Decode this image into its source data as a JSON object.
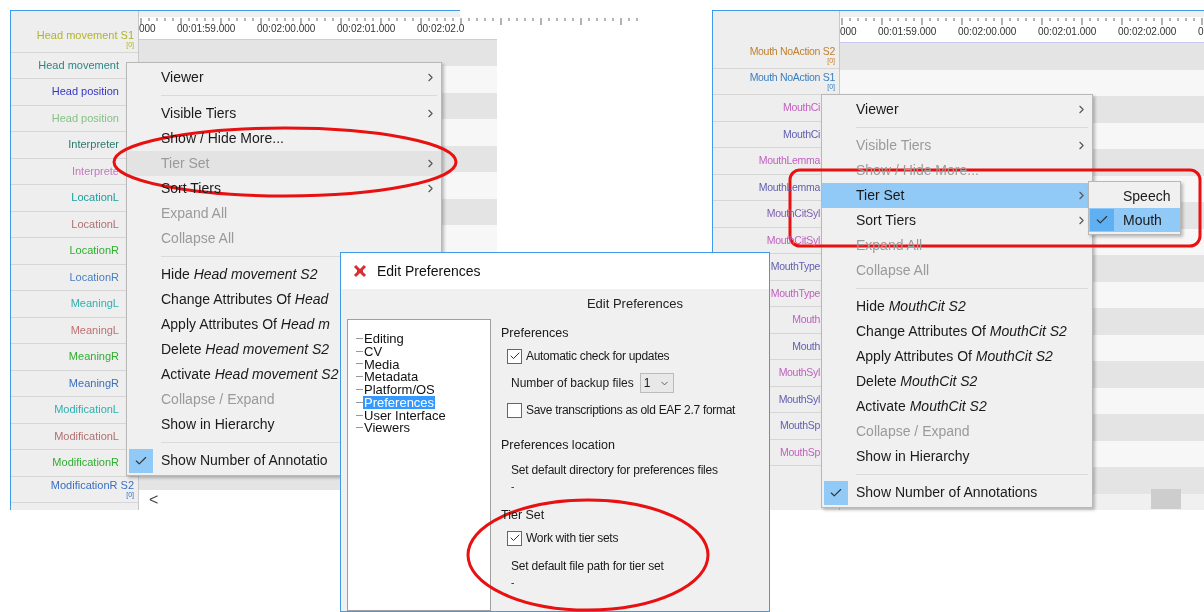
{
  "left_window": {
    "ruler": [
      "000",
      "00:01:59.000",
      "00:02:00.000",
      "00:02:01.000",
      "00:02:02.0"
    ],
    "tiers": [
      {
        "label": "Head movement S1",
        "color": "#b3b32a",
        "count": "[0]"
      },
      {
        "label": "Head movement",
        "color": "#2a8585"
      },
      {
        "label": "Head position",
        "color": "#3535c8"
      },
      {
        "label": "Head position",
        "color": "#86c286"
      },
      {
        "label": "Interpreter",
        "color": "#2a7a6e"
      },
      {
        "label": "Interprete",
        "color": "#c07ac0"
      },
      {
        "label": "LocationL",
        "color": "#1a9e9e"
      },
      {
        "label": "LocationL",
        "color": "#b07070"
      },
      {
        "label": "LocationR",
        "color": "#2fae2f"
      },
      {
        "label": "LocationR",
        "color": "#4a7fc0"
      },
      {
        "label": "MeaningL",
        "color": "#2fb0b0"
      },
      {
        "label": "MeaningL",
        "color": "#c07070"
      },
      {
        "label": "MeaningR",
        "color": "#2fae2f"
      },
      {
        "label": "MeaningR",
        "color": "#3a6fc0"
      },
      {
        "label": "ModificationL",
        "color": "#2fb0b0"
      },
      {
        "label": "ModificationL",
        "color": "#b07070"
      },
      {
        "label": "ModificationR",
        "color": "#2fae2f"
      },
      {
        "label": "ModificationR S2",
        "color": "#3a6fc0",
        "count": "[0]"
      }
    ],
    "scroll_left": "<",
    "context_menu": [
      {
        "kind": "item",
        "text": "Viewer",
        "submenu": true,
        "disabled": false,
        "selected": false,
        "checked": false
      },
      {
        "kind": "separator"
      },
      {
        "kind": "item",
        "text": "Visible Tiers",
        "submenu": true,
        "disabled": false,
        "selected": false,
        "checked": false
      },
      {
        "kind": "item",
        "text": "Show / Hide More...",
        "submenu": false,
        "disabled": false,
        "selected": false,
        "checked": false
      },
      {
        "kind": "item",
        "text": "Tier Set",
        "submenu": true,
        "disabled": true,
        "selected": true,
        "checked": false
      },
      {
        "kind": "item",
        "text": "Sort Tiers",
        "submenu": true,
        "disabled": false,
        "selected": false,
        "checked": false
      },
      {
        "kind": "item",
        "text": "Expand All",
        "submenu": false,
        "disabled": true,
        "selected": false,
        "checked": false
      },
      {
        "kind": "item",
        "text": "Collapse All",
        "submenu": false,
        "disabled": true,
        "selected": false,
        "checked": false
      },
      {
        "kind": "separator"
      },
      {
        "kind": "item",
        "text": "Hide *Head movement S2*",
        "disabled": false,
        "selected": false,
        "checked": false
      },
      {
        "kind": "item",
        "text": "Change Attributes Of *Head*",
        "disabled": false,
        "selected": false,
        "checked": false
      },
      {
        "kind": "item",
        "text": "Apply Attributes Of *Head m*",
        "disabled": false,
        "selected": false,
        "checked": false
      },
      {
        "kind": "item",
        "text": "Delete *Head movement S2*",
        "disabled": false,
        "selected": false,
        "checked": false
      },
      {
        "kind": "item",
        "text": "Activate *Head movement S2*",
        "disabled": false,
        "selected": false,
        "checked": false
      },
      {
        "kind": "item",
        "text": "Collapse / Expand",
        "disabled": true,
        "selected": false,
        "checked": false
      },
      {
        "kind": "item",
        "text": "Show in Hierarchy",
        "disabled": false,
        "selected": false,
        "checked": false
      },
      {
        "kind": "separator"
      },
      {
        "kind": "item",
        "text": "Show Number of Annotatio",
        "disabled": false,
        "selected": false,
        "checked": true
      }
    ]
  },
  "right_window": {
    "ruler": [
      "000",
      "00:01:59.000",
      "00:02:00.000",
      "00:02:01.000",
      "00:02:02.000",
      "0"
    ],
    "tiers": [
      {
        "label": "Mouth NoAction S2",
        "color": "#c0802f",
        "count": "[0]"
      },
      {
        "label": "Mouth NoAction S1",
        "color": "#3a80c0",
        "count": "[0]"
      },
      {
        "label": "MouthCi",
        "color": "#c060c0"
      },
      {
        "label": "MouthCi",
        "color": "#6060b0"
      },
      {
        "label": "MouthLemma",
        "color": "#c060c0"
      },
      {
        "label": "MouthLemma",
        "color": "#6060b0"
      },
      {
        "label": "MouthCitSyl",
        "color": "#8060b0"
      },
      {
        "label": "MouthCitSyl",
        "color": "#c060c0"
      },
      {
        "label": "MouthType",
        "color": "#6060b0"
      },
      {
        "label": "MouthType",
        "color": "#c060c0"
      },
      {
        "label": "Mouth",
        "color": "#c060c0"
      },
      {
        "label": "Mouth",
        "color": "#6060b0"
      },
      {
        "label": "MouthSyl",
        "color": "#c060c0"
      },
      {
        "label": "MouthSyl",
        "color": "#6060b0"
      },
      {
        "label": "MouthSp",
        "color": "#6060b0"
      },
      {
        "label": "MouthSp",
        "color": "#c060c0"
      }
    ],
    "context_menu": [
      {
        "kind": "item",
        "text": "Viewer",
        "submenu": true,
        "disabled": false,
        "selected": false,
        "checked": false
      },
      {
        "kind": "separator"
      },
      {
        "kind": "item",
        "text": "Visible Tiers",
        "submenu": true,
        "disabled": true,
        "selected": false,
        "checked": false
      },
      {
        "kind": "item",
        "text": "Show / Hide More...",
        "submenu": false,
        "disabled": true,
        "selected": false,
        "checked": false
      },
      {
        "kind": "item",
        "text": "Tier Set",
        "submenu": true,
        "disabled": false,
        "selected": true,
        "checked": false
      },
      {
        "kind": "item",
        "text": "Sort Tiers",
        "submenu": true,
        "disabled": false,
        "selected": false,
        "checked": false
      },
      {
        "kind": "item",
        "text": "Expand All",
        "submenu": false,
        "disabled": true,
        "selected": false,
        "checked": false
      },
      {
        "kind": "item",
        "text": "Collapse All",
        "submenu": false,
        "disabled": true,
        "selected": false,
        "checked": false
      },
      {
        "kind": "separator"
      },
      {
        "kind": "item",
        "text": "Hide *MouthCit S2*",
        "submenu": false,
        "disabled": false,
        "selected": false,
        "checked": false
      },
      {
        "kind": "item",
        "text": "Change Attributes Of *MouthCit S2*",
        "submenu": false,
        "disabled": false,
        "selected": false,
        "checked": false
      },
      {
        "kind": "item",
        "text": "Apply Attributes Of *MouthCit S2*",
        "submenu": false,
        "disabled": false,
        "selected": false,
        "checked": false
      },
      {
        "kind": "item",
        "text": "Delete *MouthCit S2*",
        "submenu": false,
        "disabled": false,
        "selected": false,
        "checked": false
      },
      {
        "kind": "item",
        "text": "Activate *MouthCit S2*",
        "submenu": false,
        "disabled": false,
        "selected": false,
        "checked": false
      },
      {
        "kind": "item",
        "text": "Collapse / Expand",
        "submenu": false,
        "disabled": true,
        "selected": false,
        "checked": false
      },
      {
        "kind": "item",
        "text": "Show in Hierarchy",
        "submenu": false,
        "disabled": false,
        "selected": false,
        "checked": false
      },
      {
        "kind": "separator"
      },
      {
        "kind": "item",
        "text": "Show Number of Annotations",
        "submenu": false,
        "disabled": false,
        "selected": false,
        "checked": true
      }
    ],
    "tier_set_submenu": [
      {
        "text": "Speech",
        "checked": false,
        "selected": false
      },
      {
        "text": "Mouth",
        "checked": true,
        "selected": true
      }
    ]
  },
  "dialog": {
    "title": "Edit Preferences",
    "heading": "Edit Preferences",
    "tree": [
      {
        "text": "Editing",
        "selected": false
      },
      {
        "text": "CV",
        "selected": false
      },
      {
        "text": "Media",
        "selected": false
      },
      {
        "text": "Metadata",
        "selected": false
      },
      {
        "text": "Platform/OS",
        "selected": false
      },
      {
        "text": "Preferences",
        "selected": true
      },
      {
        "text": "User Interface",
        "selected": false
      },
      {
        "text": "Viewers",
        "selected": false
      }
    ],
    "sections": [
      {
        "kind": "heading",
        "text": "Preferences"
      },
      {
        "kind": "checkbox",
        "text": "Automatic check for updates",
        "checked": true
      },
      {
        "kind": "select",
        "text": "Number of backup files",
        "value": "1"
      },
      {
        "kind": "checkbox",
        "text": "Save transcriptions as old EAF 2.7 format",
        "checked": false
      },
      {
        "kind": "heading",
        "text": "Preferences location"
      },
      {
        "kind": "label",
        "text": "Set default directory for preferences files"
      },
      {
        "kind": "path",
        "text": "-"
      },
      {
        "kind": "heading",
        "text": "Tier Set"
      },
      {
        "kind": "checkbox",
        "text": "Work with tier sets",
        "checked": true
      },
      {
        "kind": "label",
        "text": "Set default file path for tier set"
      },
      {
        "kind": "path",
        "text": "-"
      }
    ]
  }
}
